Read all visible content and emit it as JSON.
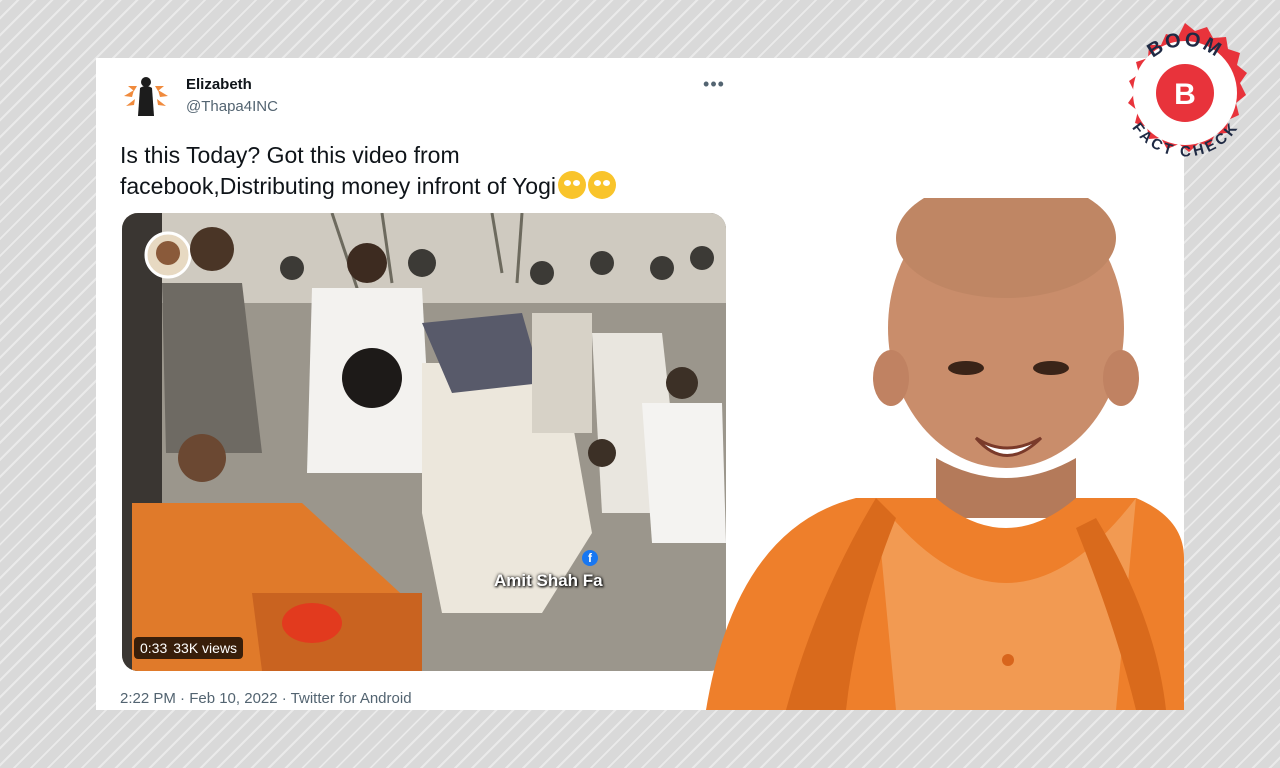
{
  "tweet": {
    "author_name": "Elizabeth",
    "author_handle": "@Thapa4INC",
    "text": "Is this Today? Got this video from facebook,Distributing money infront of Yogi",
    "emoji": [
      "rolling-eyes-emoji",
      "rolling-eyes-emoji"
    ],
    "video": {
      "duration": "0:33",
      "views": "33K views",
      "watermark": "Amit Shah Fa"
    },
    "timestamp": "2:22 PM · Feb 10, 2022 · Twitter for Android"
  },
  "logo": {
    "top_text": "BOOM",
    "bottom_text": "FACT CHECK",
    "letter": "B",
    "colors": {
      "ring": "#e8333b",
      "inner": "#ffffff",
      "badge": "#e8333b"
    }
  },
  "colors": {
    "saffron": "#ee7f2b",
    "text_primary": "#0f1419",
    "text_secondary": "#536471"
  }
}
